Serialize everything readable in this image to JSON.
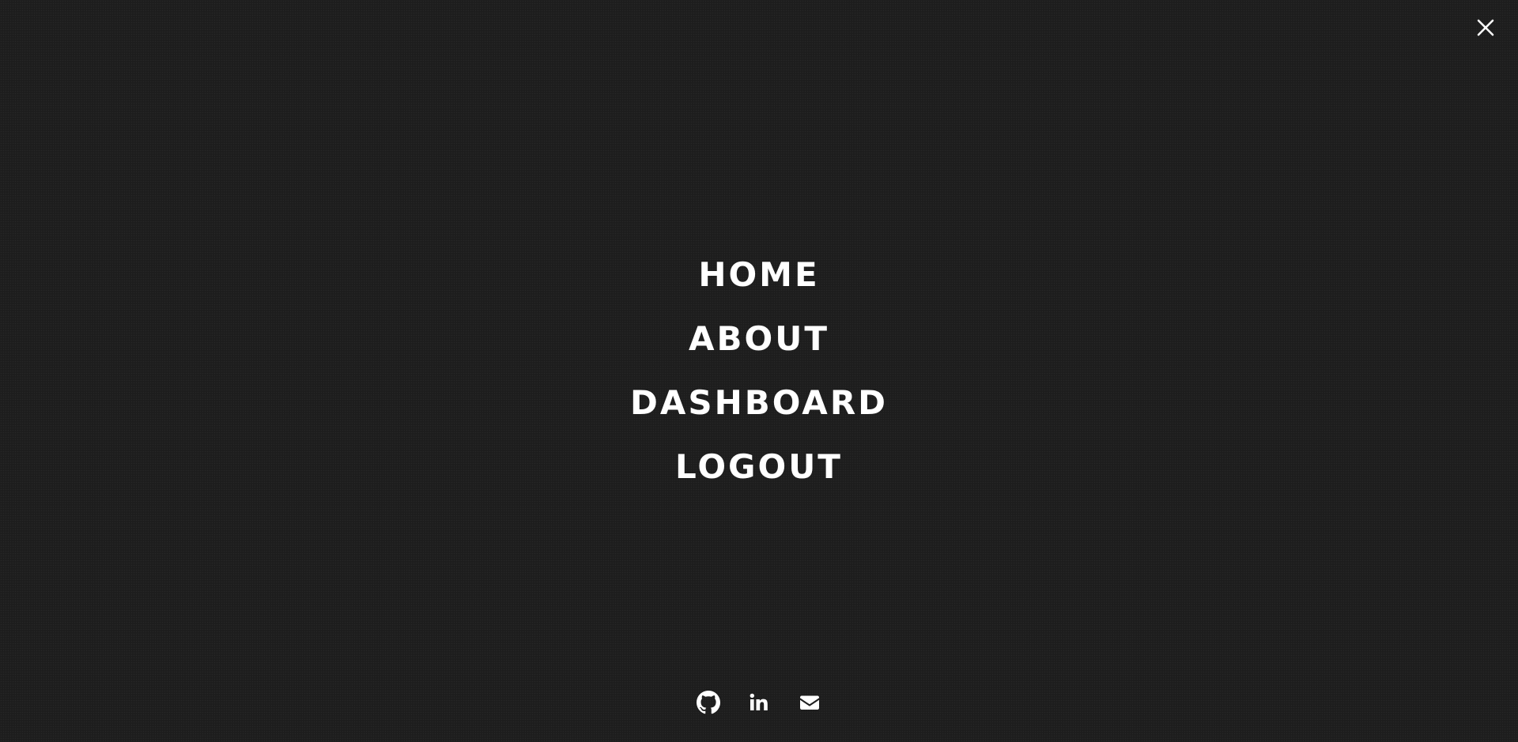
{
  "nav": {
    "items": [
      {
        "label": "HOME"
      },
      {
        "label": "ABOUT"
      },
      {
        "label": "DASHBOARD"
      },
      {
        "label": "LOGOUT"
      }
    ]
  },
  "close": {
    "icon": "close-icon"
  },
  "socials": [
    {
      "icon": "github-icon"
    },
    {
      "icon": "linkedin-icon"
    },
    {
      "icon": "mail-icon"
    }
  ],
  "colors": {
    "background": "#1f1f1f",
    "text": "#ffffff"
  }
}
